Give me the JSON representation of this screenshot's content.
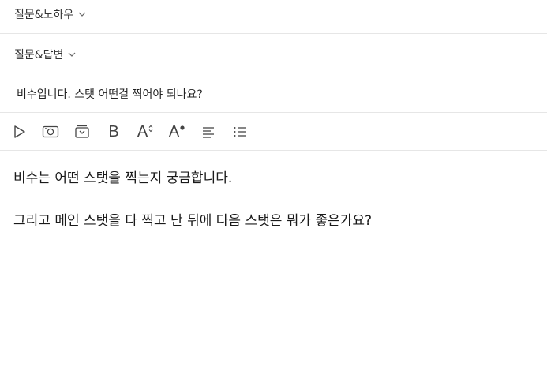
{
  "board_select": {
    "value": "질문&노하우",
    "icon": "chevron-down-icon"
  },
  "category_select": {
    "value": "질문&답변",
    "icon": "chevron-down-icon"
  },
  "title": {
    "value": "비수입니다. 스탯 어떤걸 찍어야 되나요?"
  },
  "toolbar": {
    "bold_label": "B",
    "font_size_label": "A",
    "font_color_label": "A",
    "icons": [
      "video-icon",
      "photo-icon",
      "archive-icon",
      "bold-icon",
      "font-size-icon",
      "font-color-icon",
      "align-icon",
      "list-icon"
    ]
  },
  "body": {
    "paragraphs": [
      "비수는 어떤 스탯을 찍는지 궁금합니다.",
      "",
      "그리고 메인 스탯을 다 찍고 난 뒤에 다음 스탯은 뭐가 좋은가요?"
    ]
  },
  "colors": {
    "border": "#e6e6e6",
    "text": "#222222",
    "icon": "#444444"
  }
}
